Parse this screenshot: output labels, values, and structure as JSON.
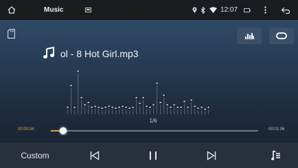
{
  "status_bar": {
    "app_title": "Music",
    "time": "12:07",
    "icons": [
      "home-icon",
      "music-app-icon",
      "location-icon",
      "bluetooth-icon",
      "wifi-icon",
      "battery-icon",
      "more-vert-icon",
      "back-icon"
    ]
  },
  "player": {
    "song_title": "ol - 8 Hot Girl.mp3",
    "track_position": "1/6",
    "elapsed": "00:00:04",
    "total": "00:01:06",
    "progress": 0.06,
    "spectrum_levels": [
      0.1,
      0.55,
      0.1,
      0.85,
      0.3,
      0.15,
      0.2,
      0.1,
      0.12,
      0.1,
      0.08,
      0.1,
      0.12,
      0.1,
      0.08,
      0.1,
      0.12,
      0.1,
      0.08,
      0.1,
      0.3,
      0.18,
      0.3,
      0.12,
      0.1,
      0.15,
      0.6,
      0.2,
      0.35,
      0.15,
      0.1,
      0.15,
      0.1,
      0.1,
      0.22,
      0.1,
      0.25,
      0.12,
      0.08,
      0.1,
      0.06,
      0.1
    ]
  },
  "controls": {
    "custom_label": "Custom",
    "icons": [
      "previous-track-icon",
      "pause-icon",
      "next-track-icon",
      "playlist-icon"
    ]
  },
  "colors": {
    "accent": "#e89a2e",
    "background_top": "#2f4a66",
    "controls_bar": "#28303b"
  }
}
